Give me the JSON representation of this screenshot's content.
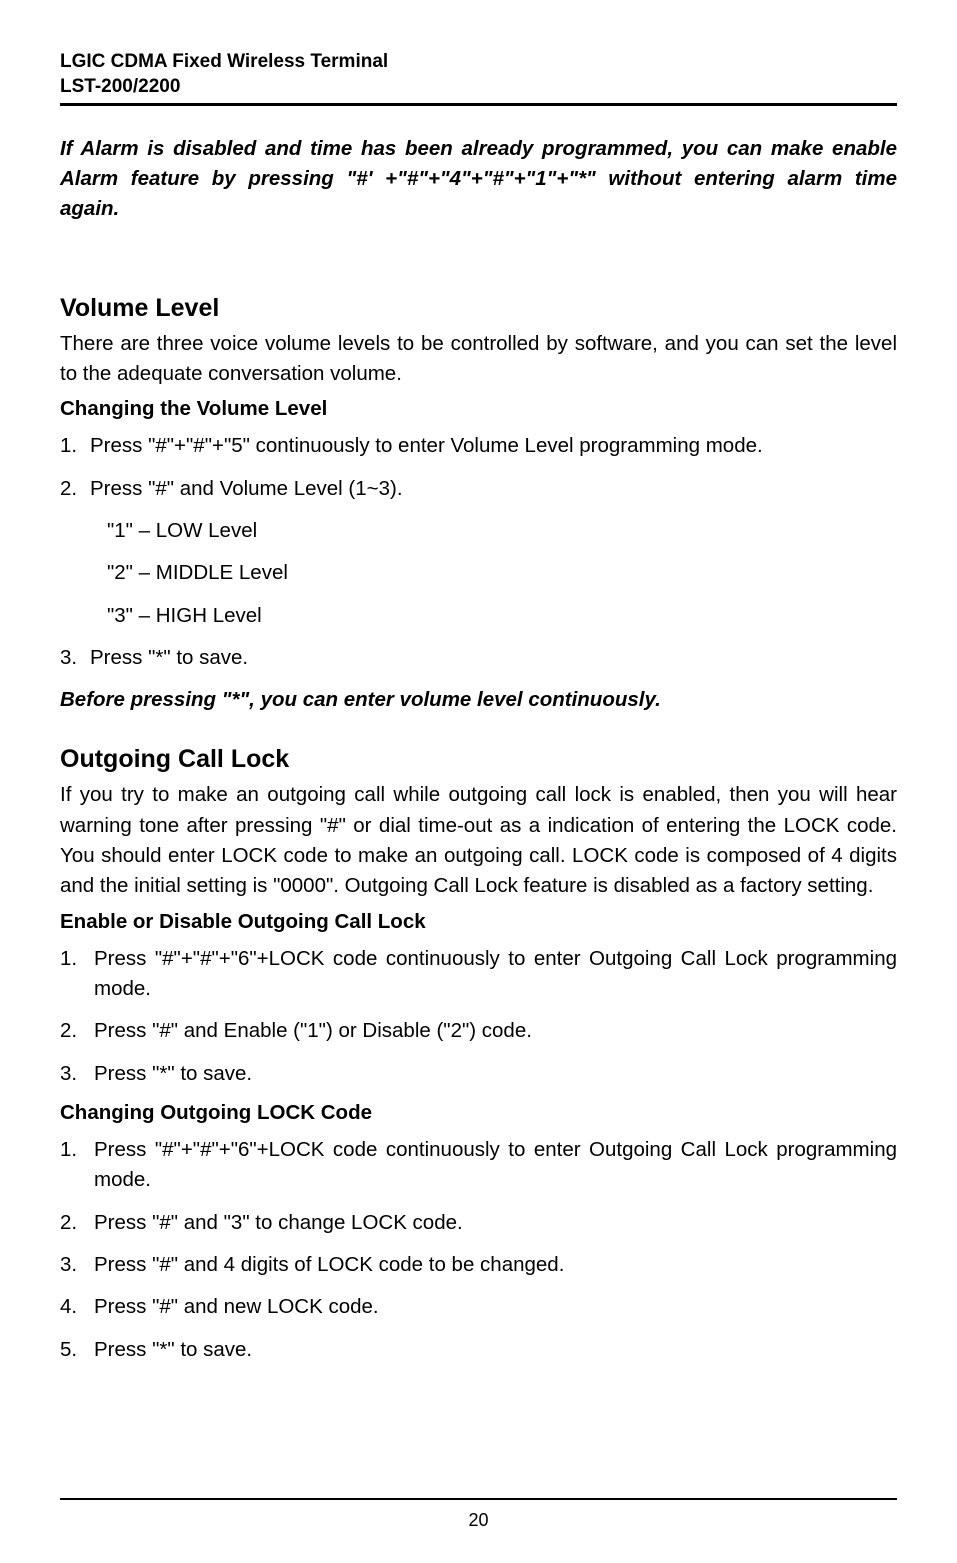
{
  "header": {
    "line1": "LGIC CDMA Fixed Wireless Terminal",
    "line2": "LST-200/2200"
  },
  "alarm_note": "If Alarm is disabled and time has been already programmed, you can make enable Alarm feature by pressing \"#' +\"#\"+\"4\"+\"#\"+\"1\"+\"*\" without entering alarm time again.",
  "sections": {
    "volume": {
      "title": "Volume Level",
      "intro": "There are three voice volume levels to be controlled by software, and you can set the level to the adequate conversation volume.",
      "sub1_title": "Changing the Volume Level",
      "step1": "Press \"#\"+\"#\"+\"5\" continuously to enter Volume Level programming mode.",
      "step2": "Press \"#\" and Volume Level (1~3).",
      "opt1": "\"1\" – LOW Level",
      "opt2": "\"2\" – MIDDLE Level",
      "opt3": "\"3\" – HIGH Level",
      "step3": "Press \"*\" to save.",
      "note": "Before pressing \"*\", you can enter volume level continuously."
    },
    "lock": {
      "title": "Outgoing Call Lock",
      "intro": "If you try to make an outgoing call while outgoing call lock is enabled, then you will hear warning tone after pressing \"#\" or dial time-out as a indication of entering the LOCK code. You should enter LOCK code to make an outgoing call. LOCK code is composed of 4 digits and the initial setting is \"0000\". Outgoing Call Lock feature is disabled as a factory setting.",
      "sub1_title": "Enable or Disable Outgoing Call Lock",
      "sub1_step1": "Press \"#\"+\"#\"+\"6\"+LOCK code continuously to enter Outgoing Call Lock programming mode.",
      "sub1_step2": "Press \"#\" and Enable (\"1\") or Disable (\"2\") code.",
      "sub1_step3": "Press \"*\" to save.",
      "sub2_title": "Changing Outgoing LOCK Code",
      "sub2_step1": "Press \"#\"+\"#\"+\"6\"+LOCK code continuously to enter Outgoing Call Lock programming mode.",
      "sub2_step2": "Press \"#\" and \"3\" to change LOCK code.",
      "sub2_step3": "Press \"#\" and 4 digits of LOCK code to be changed.",
      "sub2_step4": "Press \"#\" and new LOCK code.",
      "sub2_step5": "Press \"*\" to save."
    }
  },
  "page_number": "20"
}
